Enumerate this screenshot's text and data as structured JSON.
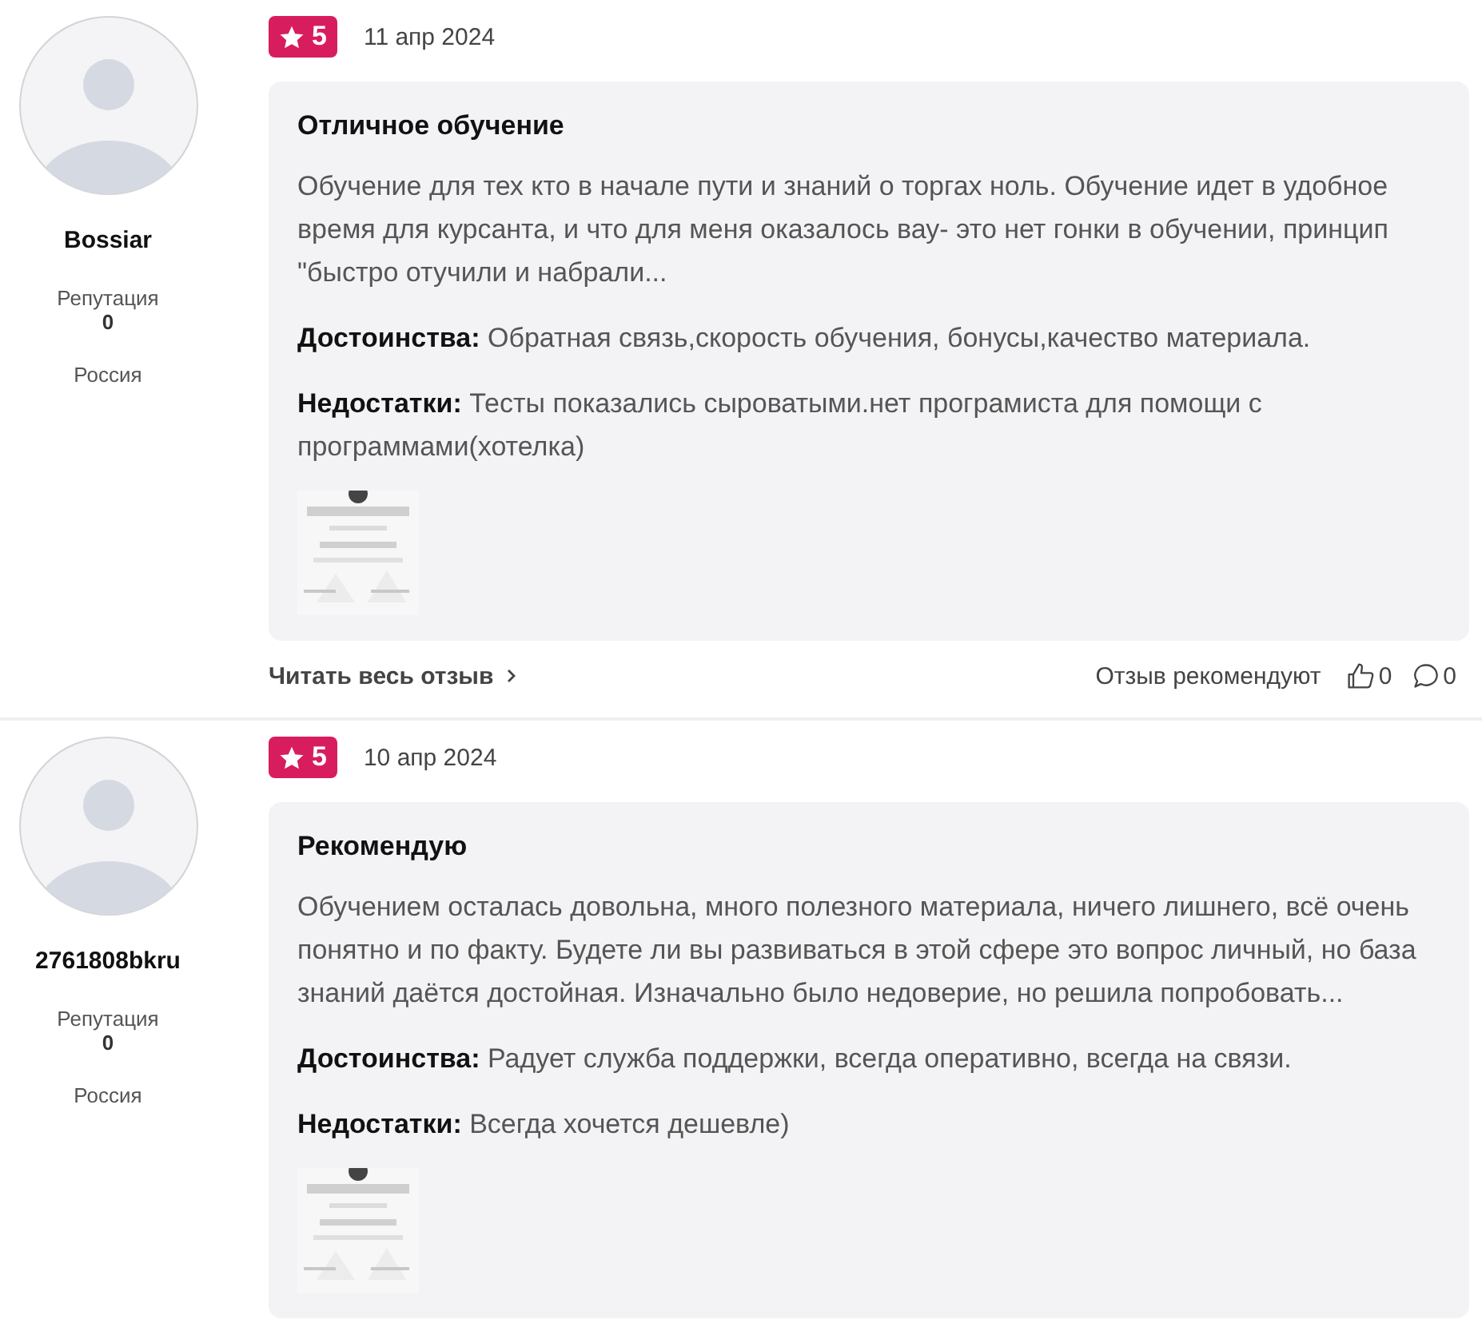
{
  "reviews": [
    {
      "author": "Bossiar",
      "reputation_label": "Репутация",
      "reputation": "0",
      "country": "Россия",
      "rating": "5",
      "date": "11 апр 2024",
      "title": "Отличное обучение",
      "text": "Обучение для тех кто в начале пути и знаний о торгах ноль. Обучение идет в удобное время для курсанта, и что для меня оказалось вау- это нет гонки в обучении, принцип \"быстро отучили и набрали...",
      "pros": "**Достоинства:** Обратная связь,скорость обучения, бонусы,качество материала.",
      "cons": "**Недостатки:** Тесты показались сыроватыми.нет програмиста для помощи с программами(хотелка)",
      "footer": {
        "read_more": "Читать весь отзыв",
        "recommend_label": "Отзыв рекомендуют",
        "likes": "0",
        "comments": "0"
      }
    },
    {
      "author": "2761808bkru",
      "reputation_label": "Репутация",
      "reputation": "0",
      "country": "Россия",
      "rating": "5",
      "date": "10 апр 2024",
      "title": "Рекомендую",
      "text": "Обучением осталась довольна, много полезного материала, ничего лишнего, всё очень понятно и по факту. Будете ли вы развиваться в этой сфере это вопрос личный, но база знаний даётся достойная. Изначально было недоверие, но решила попробовать...",
      "pros": "**Достоинства:** Радует служба поддержки, всегда оперативно, всегда на связи.",
      "cons": "**Недостатки:** Всегда хочется дешевле)"
    }
  ]
}
